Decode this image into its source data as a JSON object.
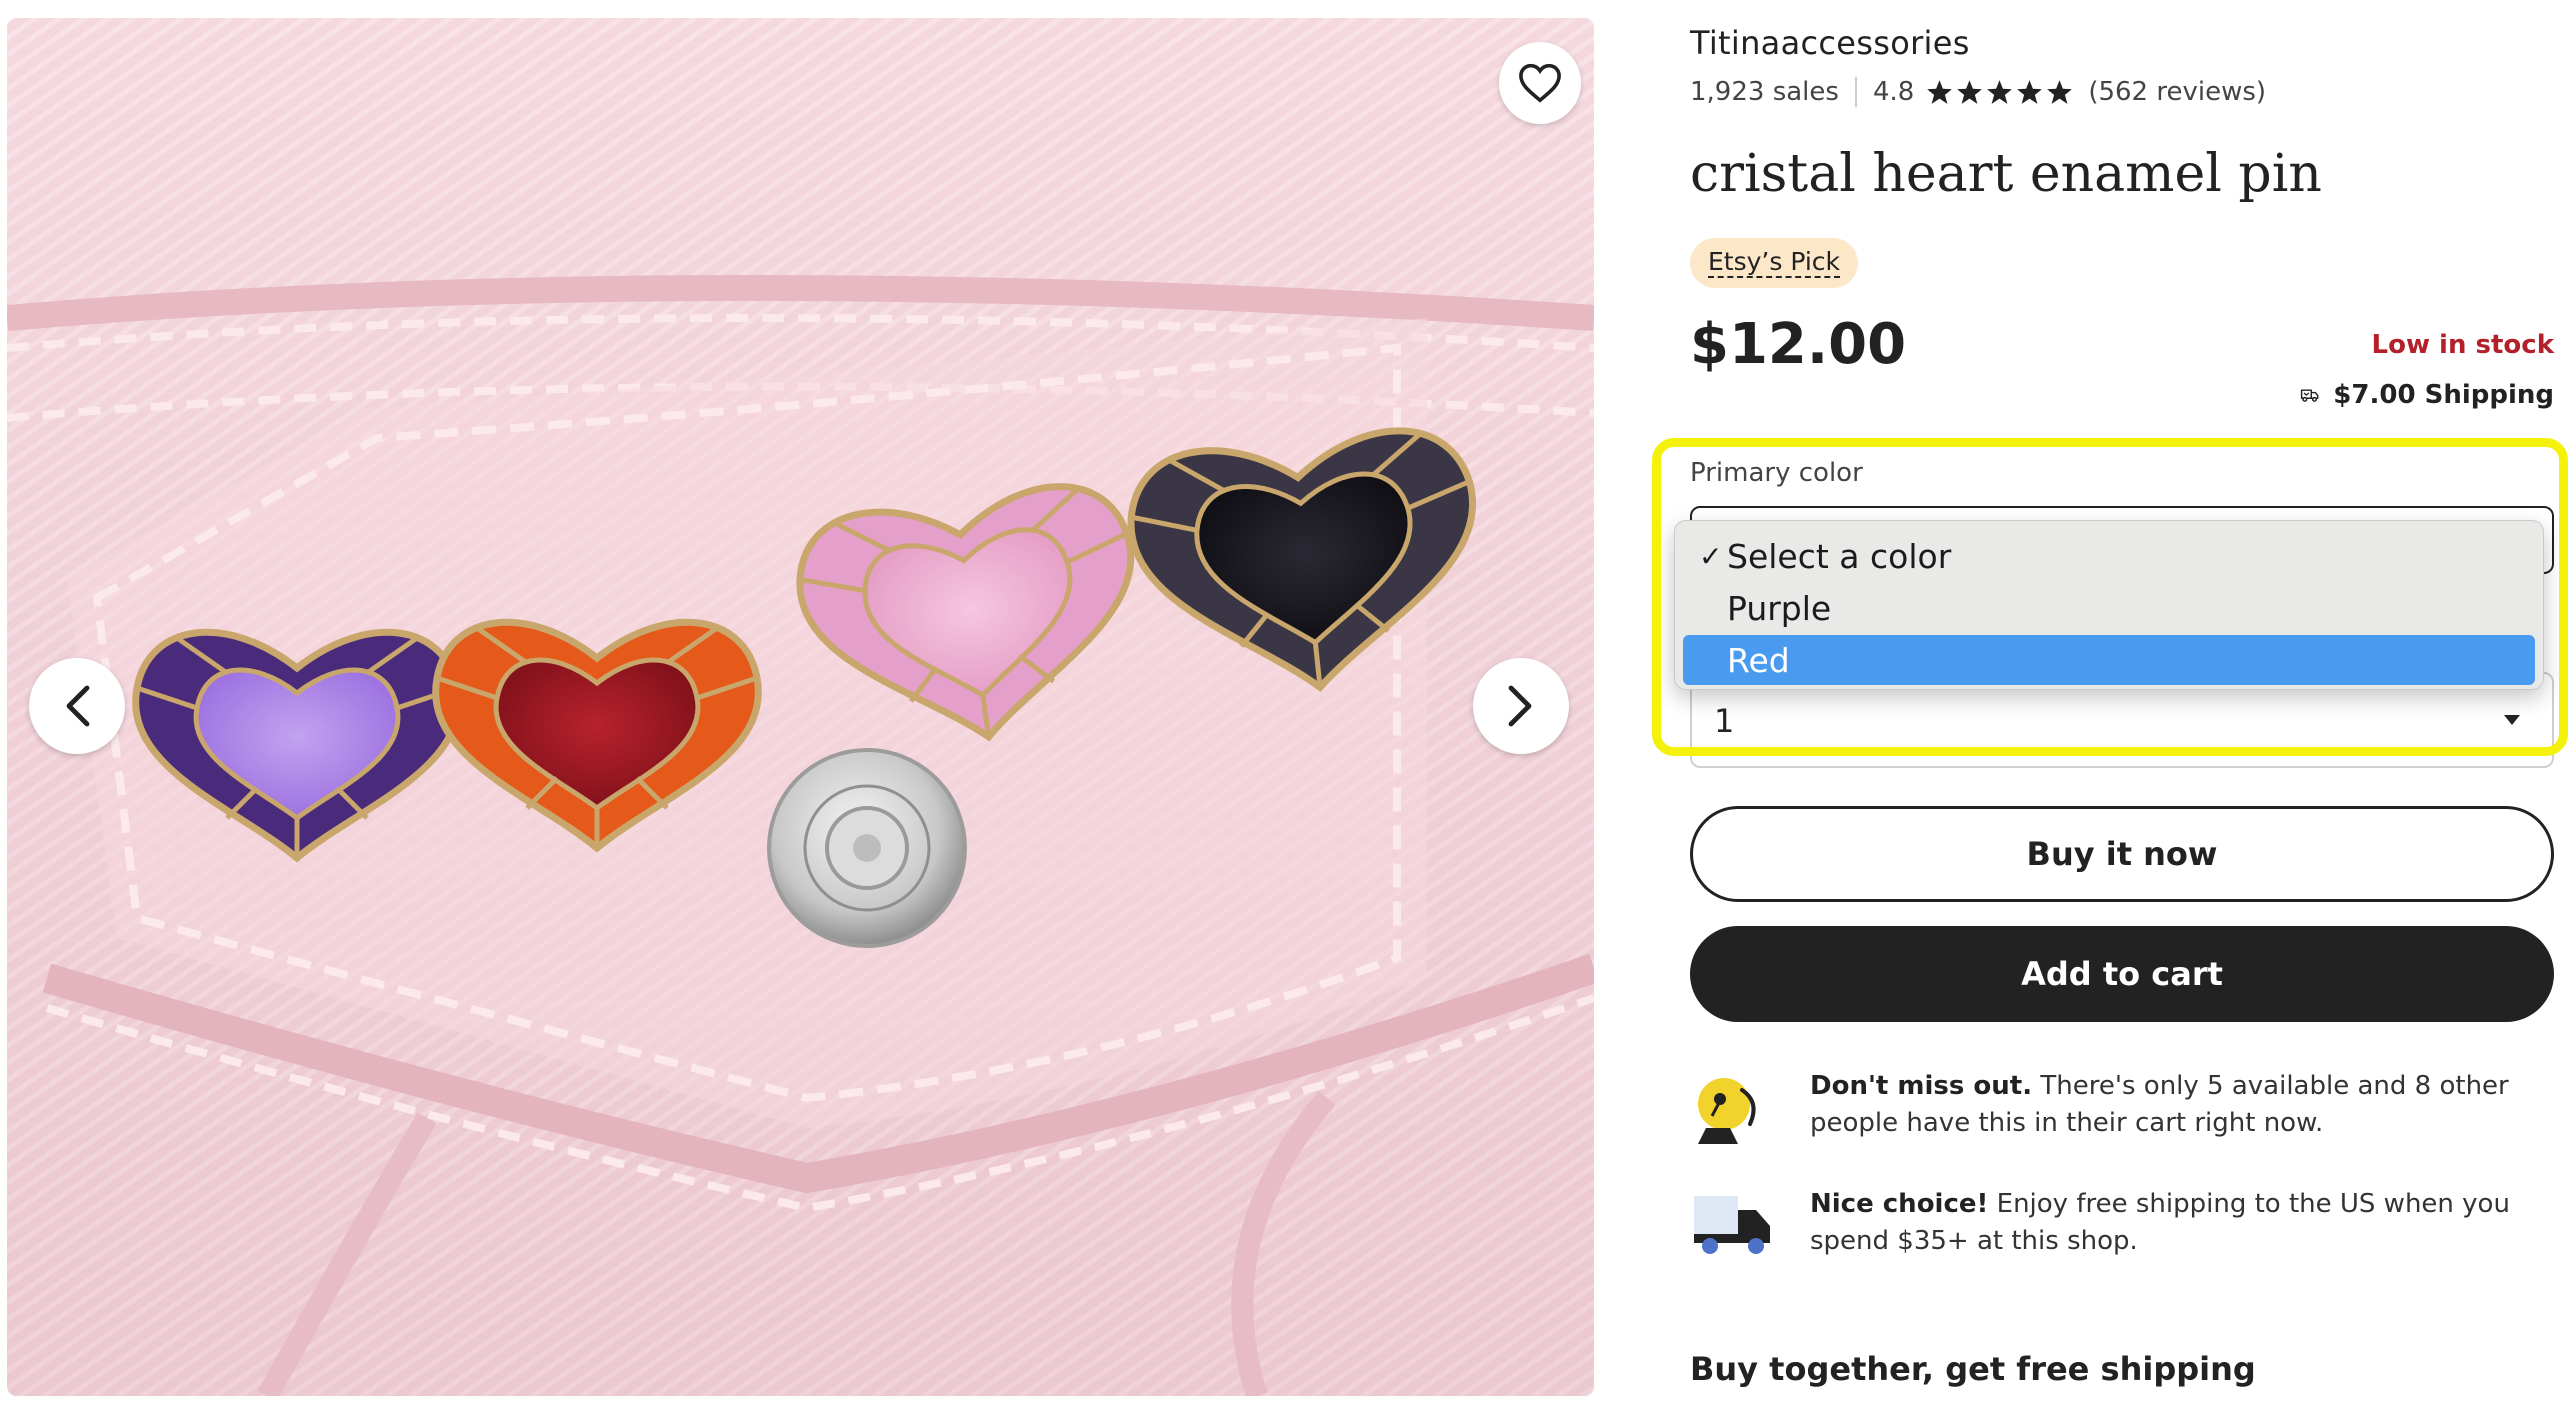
{
  "shop": {
    "name": "Titinaaccessories",
    "sales": "1,923 sales",
    "rating": "4.8",
    "rating_stars": 5,
    "reviews": "(562 reviews)"
  },
  "product": {
    "title": "cristal heart enamel pin",
    "badge": "Etsy’s Pick",
    "price": "$12.00",
    "stock_status": "Low in stock",
    "shipping": "$7.00 Shipping"
  },
  "variation": {
    "label": "Primary color",
    "options": [
      "Select a color",
      "Purple",
      "Red"
    ],
    "checked_option": "Select a color",
    "highlighted_option": "Red"
  },
  "quantity": {
    "value": "1"
  },
  "actions": {
    "buy_now": "Buy it now",
    "add_to_cart": "Add to cart"
  },
  "notices": [
    {
      "icon": "alarm-bell-icon",
      "bold": "Don't miss out.",
      "text": "There's only 5 available and 8 other people have this in their cart right now."
    },
    {
      "icon": "delivery-truck-icon",
      "bold": "Nice choice!",
      "text": "Enjoy free shipping to the US when you spend $35+ at this shop."
    }
  ],
  "section_heading": "Buy together, get free shipping",
  "colors": {
    "highlight": "#f4f10b",
    "low_stock": "#b3202a",
    "badge_bg": "#fde7c9",
    "option_highlight": "#4a9bf0",
    "cart_button": "#222222"
  }
}
